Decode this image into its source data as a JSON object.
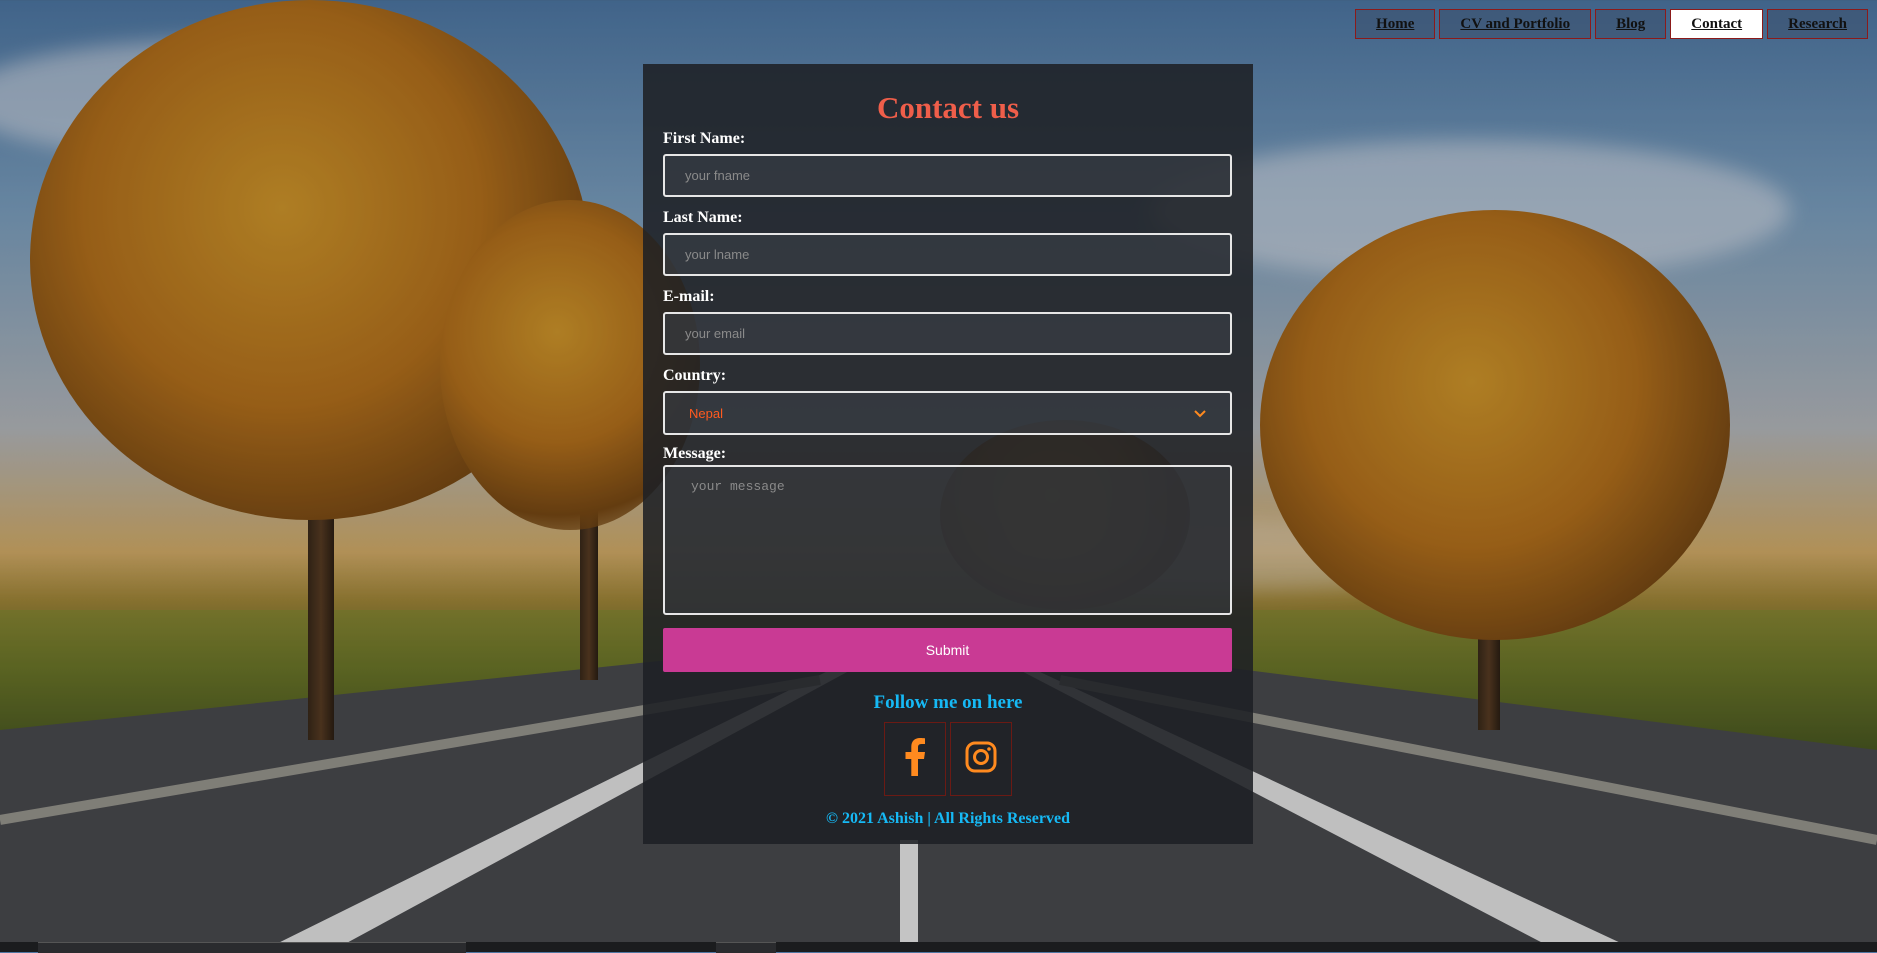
{
  "nav": {
    "items": [
      {
        "label": "Home"
      },
      {
        "label": "CV and Portfolio"
      },
      {
        "label": "Blog"
      },
      {
        "label": "Contact"
      },
      {
        "label": "Research"
      }
    ],
    "active_index": 3
  },
  "form": {
    "title": "Contact us",
    "first_name": {
      "label": "First Name:",
      "placeholder": "your fname"
    },
    "last_name": {
      "label": "Last Name:",
      "placeholder": "your lname"
    },
    "email": {
      "label": "E-mail:",
      "placeholder": "your email"
    },
    "country": {
      "label": "Country:",
      "value": "Nepal"
    },
    "message": {
      "label": "Message:",
      "placeholder": "your message"
    },
    "submit_label": "Submit"
  },
  "social": {
    "heading": "Follow me on here",
    "icons": [
      "facebook-icon",
      "instagram-icon"
    ]
  },
  "footer": {
    "copyright": "© 2021 Ashish | All Rights Reserved"
  },
  "colors": {
    "title": "#ef5e4a",
    "accent_blue": "#16b9f5",
    "submit": "#c93a94",
    "select_text": "#ff5a1f",
    "icon_orange": "#ff8a1f"
  }
}
